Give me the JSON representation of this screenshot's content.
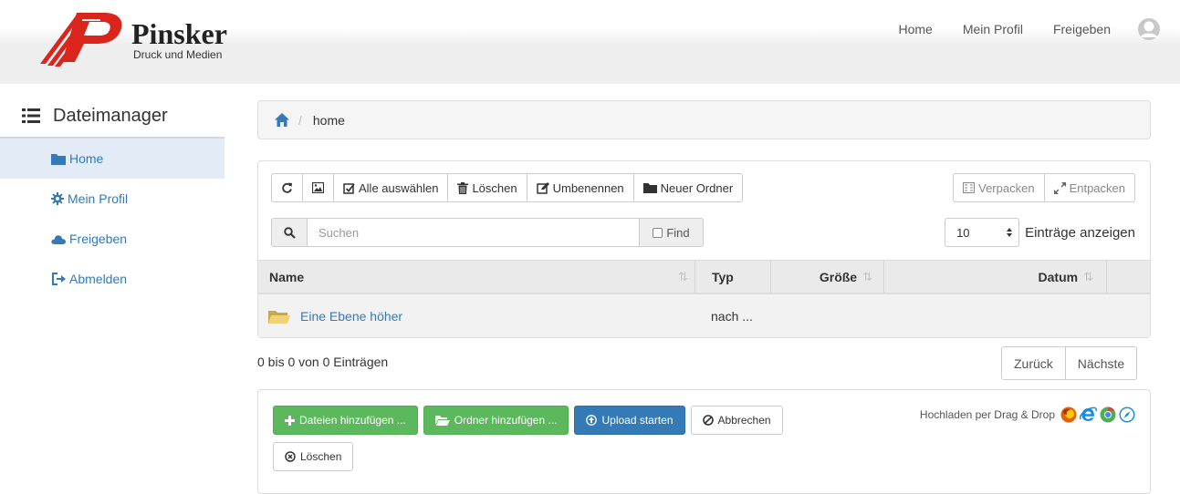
{
  "header": {
    "logo": {
      "name": "Pinsker",
      "subtitle": "Druck und Medien"
    },
    "nav": [
      {
        "label": "Home"
      },
      {
        "label": "Mein Profil"
      },
      {
        "label": "Freigeben"
      }
    ]
  },
  "sidebar": {
    "title": "Dateimanager",
    "items": [
      {
        "label": "Home",
        "icon": "folder-icon",
        "active": true
      },
      {
        "label": "Mein Profil",
        "icon": "gear-icon"
      },
      {
        "label": "Freigeben",
        "icon": "cloud-icon"
      },
      {
        "label": "Abmelden",
        "icon": "logout-icon"
      }
    ]
  },
  "breadcrumb": {
    "current": "home"
  },
  "toolbar": {
    "select_all": "Alle auswählen",
    "delete": "Löschen",
    "rename": "Umbenennen",
    "new_folder": "Neuer Ordner",
    "pack": "Verpacken",
    "unpack": "Entpacken"
  },
  "search": {
    "placeholder": "Suchen",
    "find_label": "Find"
  },
  "entries": {
    "selected": "10",
    "label": "Einträge anzeigen"
  },
  "table": {
    "columns": [
      "Name",
      "Typ",
      "Größe",
      "Datum"
    ],
    "rows": [
      {
        "name": "Eine Ebene höher",
        "type": "nach ...",
        "size": "",
        "date": ""
      }
    ]
  },
  "pagination": {
    "info": "0 bis 0 von 0 Einträgen",
    "prev": "Zurück",
    "next": "Nächste"
  },
  "upload": {
    "add_files": "Dateien hinzufügen ...",
    "add_folder": "Ordner hinzufügen ...",
    "start": "Upload starten",
    "cancel": "Abbrechen",
    "delete": "Löschen",
    "dragdrop": "Hochladen per Drag & Drop"
  },
  "colors": {
    "primary": "#337ab7",
    "success": "#5cb85c",
    "logo_red": "#d9251c"
  }
}
